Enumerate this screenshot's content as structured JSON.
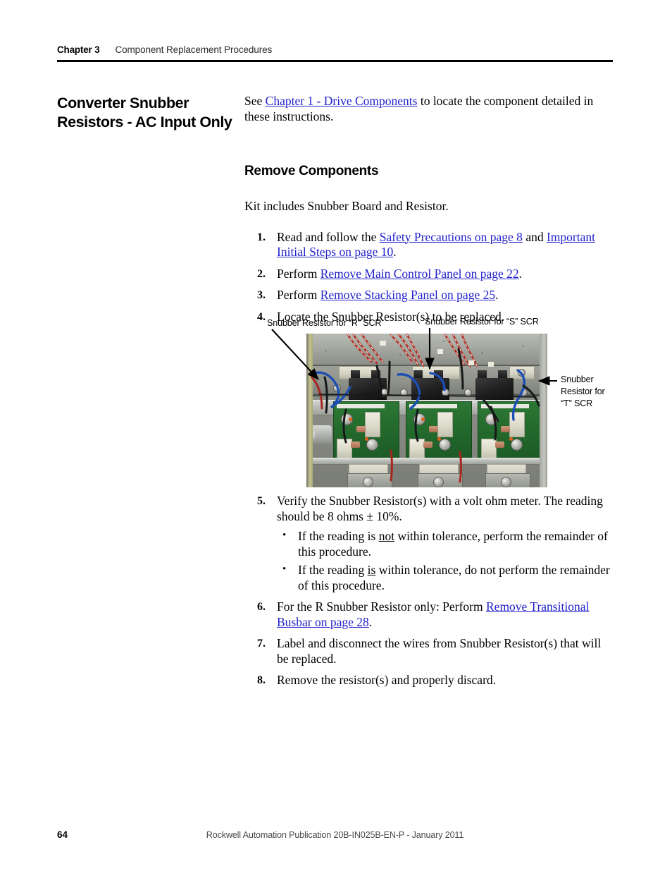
{
  "header": {
    "chapter": "Chapter 3",
    "title": "Component Replacement Procedures"
  },
  "side_heading": "Converter Snubber Resistors - AC Input Only",
  "intro": {
    "prefix": "See ",
    "link": "Chapter 1 - Drive Components",
    "suffix": " to locate the component detailed in these instructions."
  },
  "section": {
    "heading": "Remove Components",
    "lead": "Kit includes Snubber Board and Resistor."
  },
  "steps": [
    {
      "num": "1.",
      "parts": [
        {
          "t": "text",
          "v": "Read and follow the "
        },
        {
          "t": "link",
          "v": "Safety Precautions on page 8"
        },
        {
          "t": "text",
          "v": " and "
        },
        {
          "t": "link",
          "v": "Important Initial Steps on page 10"
        },
        {
          "t": "text",
          "v": "."
        }
      ]
    },
    {
      "num": "2.",
      "parts": [
        {
          "t": "text",
          "v": "Perform "
        },
        {
          "t": "link",
          "v": "Remove Main Control Panel on page 22"
        },
        {
          "t": "text",
          "v": "."
        }
      ]
    },
    {
      "num": "3.",
      "parts": [
        {
          "t": "text",
          "v": "Perform "
        },
        {
          "t": "link",
          "v": "Remove Stacking Panel on page 25"
        },
        {
          "t": "text",
          "v": "."
        }
      ]
    },
    {
      "num": "4.",
      "parts": [
        {
          "t": "text",
          "v": "Locate the Snubber Resistor(s) to be replaced."
        }
      ]
    }
  ],
  "steps_after": [
    {
      "num": "5.",
      "parts": [
        {
          "t": "text",
          "v": "Verify the Snubber Resistor(s) with a volt ohm meter. The reading should be 8 ohms ± 10%."
        }
      ],
      "bullets": [
        {
          "bullet": "•",
          "parts": [
            {
              "t": "text",
              "v": "If the reading is "
            },
            {
              "t": "underline",
              "v": "not"
            },
            {
              "t": "text",
              "v": " within tolerance, perform the remainder of this procedure."
            }
          ]
        },
        {
          "bullet": "•",
          "parts": [
            {
              "t": "text",
              "v": "If the reading "
            },
            {
              "t": "underline",
              "v": "is"
            },
            {
              "t": "text",
              "v": " within tolerance, do not perform the remainder of this procedure."
            }
          ]
        }
      ]
    },
    {
      "num": "6.",
      "parts": [
        {
          "t": "text",
          "v": "For the R Snubber Resistor only: Perform "
        },
        {
          "t": "link",
          "v": "Remove Transitional Busbar on page 28"
        },
        {
          "t": "text",
          "v": "."
        }
      ]
    },
    {
      "num": "7.",
      "parts": [
        {
          "t": "text",
          "v": "Label and disconnect the wires from Snubber Resistor(s) that will be replaced."
        }
      ]
    },
    {
      "num": "8.",
      "parts": [
        {
          "t": "text",
          "v": "Remove the resistor(s) and properly discard."
        }
      ]
    }
  ],
  "figure": {
    "label_r": "Snubber Resistor for “R” SCR",
    "label_s": "Snubber Resistor for “S” SCR",
    "label_t": "Snubber Resistor for “T” SCR",
    "alt": "Photograph of converter stack showing three snubber resistors and snubber boards"
  },
  "footer": {
    "page_number": "64",
    "publication": "Rockwell Automation Publication 20B-IN025B-EN-P - January 2011"
  },
  "colors": {
    "link": "#2222cc",
    "rule": "#000000",
    "header_title": "#2b2b2b",
    "footer_text": "#4a4a4a"
  }
}
